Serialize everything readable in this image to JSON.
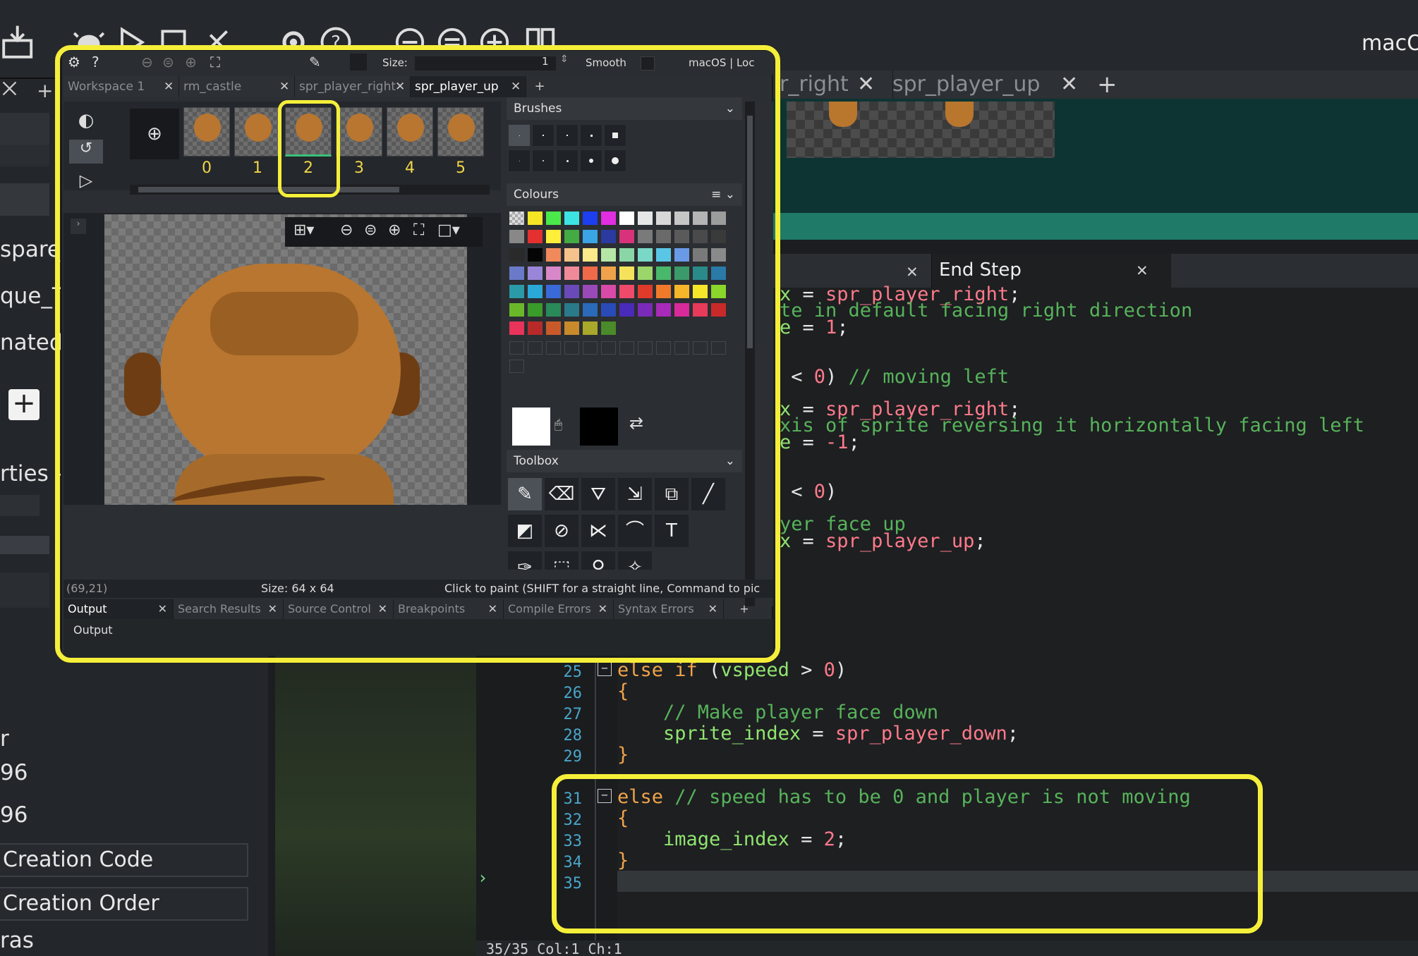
{
  "topbar": {
    "platform_label": "macO",
    "icons": [
      "build-icon",
      "debug-icon",
      "run-icon",
      "stop-icon",
      "clean-icon",
      "settings-icon",
      "help-icon",
      "zoom-out-icon",
      "zoom-reset-icon",
      "zoom-in-icon",
      "layout-icon"
    ]
  },
  "left_panel": {
    "items": [
      "spare_",
      "que_T",
      "nated_",
      "rties -",
      "r",
      "96",
      "96",
      "ras"
    ],
    "buttons": [
      "Creation Code",
      "Creation Order"
    ]
  },
  "sprite_editor": {
    "toolbar": {
      "size_label": "Size:",
      "size_value": "1",
      "smooth_label": "Smooth",
      "platform": "macOS | Loc"
    },
    "tabs": [
      "Workspace 1",
      "rm_castle",
      "spr_player_right",
      "spr_player_up"
    ],
    "active_tab": "spr_player_up",
    "frames": [
      "0",
      "1",
      "2",
      "3",
      "4",
      "5"
    ],
    "selected_frame": "2",
    "brushes_label": "Brushes",
    "colours_label": "Colours",
    "toolbox_label": "Toolbox",
    "status": {
      "coords": "(69,21)",
      "size": "Size: 64 x 64",
      "hint": "Click to paint (SHIFT for a straight line, Command to pic"
    },
    "output_tabs": [
      "Output",
      "Search Results",
      "Source Control",
      "Breakpoints",
      "Compile Errors",
      "Syntax Errors"
    ],
    "output_label": "Output",
    "colors": {
      "row1": [
        "#e8e8e8",
        "#f5e625",
        "#4be84b",
        "#3ee3e3",
        "#1d3ff0",
        "#e02ee0",
        "#ffffff",
        "#e6e6e6",
        "#d8d8d8",
        "#c6c6c6",
        "#b4b4b4",
        "#9c9c9c"
      ],
      "row2": [
        "#888888",
        "#e53030",
        "#ffee3a",
        "#44aa44",
        "#3aa4e4",
        "#2b3a9e",
        "#d8337a",
        "#7a7a7a",
        "#6a6a6a",
        "#5a5a5a",
        "#4a4a4a",
        "#3a3a3a"
      ],
      "row3": [
        "#2a2a2a",
        "#050505",
        "#f08a5a",
        "#f4c28a",
        "#fce98a",
        "#b6e6a6",
        "#8ad6a6",
        "#7ad8c6",
        "#5ac6e6",
        "#6a9ae6",
        "#7a7a7a",
        "#8a8a8a"
      ],
      "row4": [
        "#6a7ac8",
        "#9a86d8",
        "#d888c8",
        "#f08a9a",
        "#f06a4a",
        "#f0a24a",
        "#f6e25a",
        "#9ad66a",
        "#4ab86a",
        "#3a9a6a",
        "#2a8a8a",
        "#2a7aa8"
      ],
      "row5": [
        "#2a9aa8",
        "#2aa8d8",
        "#3a6ad8",
        "#6a4ab8",
        "#9a4ab8",
        "#d84aa8",
        "#f04a6a",
        "#e03a2a",
        "#f07a2a",
        "#f6b62a",
        "#f6e62a",
        "#8ad62a"
      ],
      "row6": [
        "#6ab82a",
        "#3a9a2a",
        "#2a8a5a",
        "#2a7a8a",
        "#2a6ab8",
        "#2a4ab8",
        "#4a2ab8",
        "#7a2ab8",
        "#a82ab8",
        "#d82a9a",
        "#e83a5a",
        "#c82a2a"
      ],
      "row7": [
        "#e8335a",
        "#b82a2a",
        "#c85a2a",
        "#c88a2a",
        "#a8a82a",
        "#4a8a2a"
      ],
      "primary": "#ffffff",
      "secondary": "#000000"
    }
  },
  "sprite_strip": {
    "tabs": [
      "r_right",
      "spr_player_up"
    ]
  },
  "editor": {
    "tabs": [
      "End Step"
    ],
    "upper_lines": [
      [
        [
          "var",
          "x"
        ],
        [
          "op",
          " = "
        ],
        [
          "asset",
          "spr_player_right"
        ],
        [
          "op",
          ";"
        ]
      ],
      [
        [
          "cmt",
          "te in default facing right direction"
        ]
      ],
      [
        [
          "var",
          "e"
        ],
        [
          "op",
          " = "
        ],
        [
          "num",
          "1"
        ],
        [
          "op",
          ";"
        ]
      ],
      [],
      [],
      [
        [
          "op",
          " < "
        ],
        [
          "num",
          "0"
        ],
        [
          "op",
          ") "
        ],
        [
          "cmt",
          "// moving left"
        ]
      ],
      [],
      [
        [
          "var",
          "x"
        ],
        [
          "op",
          " = "
        ],
        [
          "asset",
          "spr_player_right"
        ],
        [
          "op",
          ";"
        ]
      ],
      [
        [
          "cmt",
          "xis of sprite reversing it horizontally facing left"
        ]
      ],
      [
        [
          "var",
          "e"
        ],
        [
          "op",
          " = "
        ],
        [
          "num",
          "-1"
        ],
        [
          "op",
          ";"
        ]
      ],
      [],
      [],
      [
        [
          "op",
          " < "
        ],
        [
          "num",
          "0"
        ],
        [
          "op",
          ")"
        ]
      ],
      [],
      [
        [
          "cmt",
          "yer face up"
        ]
      ],
      [
        [
          "var",
          "x"
        ],
        [
          "op",
          " = "
        ],
        [
          "asset",
          "spr_player_up"
        ],
        [
          "op",
          ";"
        ]
      ]
    ],
    "lower_lines": [
      {
        "n": "25",
        "code": [
          [
            "kw",
            "else if"
          ],
          [
            "op",
            " ("
          ],
          [
            "var",
            "vspeed"
          ],
          [
            "op",
            " > "
          ],
          [
            "num",
            "0"
          ],
          [
            "op",
            ")"
          ]
        ]
      },
      {
        "n": "26",
        "code": [
          [
            "kw",
            "{"
          ]
        ]
      },
      {
        "n": "27",
        "code": [
          [
            "op",
            "    "
          ],
          [
            "cmt",
            "// Make player face down"
          ]
        ]
      },
      {
        "n": "28",
        "code": [
          [
            "op",
            "    "
          ],
          [
            "var",
            "sprite_index"
          ],
          [
            "op",
            " = "
          ],
          [
            "asset",
            "spr_player_down"
          ],
          [
            "op",
            ";"
          ]
        ]
      },
      {
        "n": "29",
        "code": [
          [
            "kw",
            "}"
          ]
        ]
      },
      {
        "n": "31",
        "code": [
          [
            "kw",
            "else"
          ],
          [
            "op",
            " "
          ],
          [
            "cmt",
            "// speed has to be 0 and player is not moving"
          ]
        ]
      },
      {
        "n": "32",
        "code": [
          [
            "kw",
            "{"
          ]
        ]
      },
      {
        "n": "33",
        "code": [
          [
            "op",
            "    "
          ],
          [
            "var",
            "image_index"
          ],
          [
            "op",
            " = "
          ],
          [
            "num",
            "2"
          ],
          [
            "op",
            ";"
          ]
        ]
      },
      {
        "n": "34",
        "code": [
          [
            "kw",
            "}"
          ]
        ]
      },
      {
        "n": "35",
        "code": []
      }
    ],
    "status": "35/35 Col:1 Ch:1"
  }
}
